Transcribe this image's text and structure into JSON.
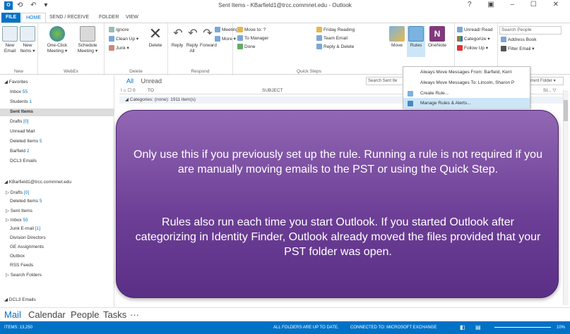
{
  "window": {
    "title": "Sent Items - KBarfield1@trcc.commnet.edu - Outlook",
    "quick_access": "⟲ ↶ ▾",
    "controls": "? ▣ – ☐ ✕"
  },
  "tabs": [
    "FILE",
    "HOME",
    "SEND / RECEIVE",
    "FOLDER",
    "VIEW"
  ],
  "ribbon": {
    "new_group": {
      "label": "New",
      "new_email": "New Email",
      "new_items": "New Items ▾"
    },
    "webex_group": {
      "label": "WebEx",
      "one_click": "One-Click Meeting ▾",
      "schedule": "Schedule Meeting ▾"
    },
    "delete_group": {
      "label": "Delete",
      "ignore": "Ignore",
      "clean_up": "Clean Up ▾",
      "junk": "Junk ▾",
      "delete": "Delete"
    },
    "respond_group": {
      "label": "Respond",
      "reply": "Reply",
      "reply_all": "Reply All",
      "forward": "Forward",
      "meeting": "Meeting",
      "more": "More ▾"
    },
    "quick_steps": {
      "label": "Quick Steps",
      "items": [
        "Move to: ?",
        "To Manager",
        "Done",
        "Friday Reading",
        "Team Email",
        "Reply & Delete"
      ]
    },
    "move_group": {
      "move": "Move",
      "rules": "Rules",
      "onenote": "OneNote"
    },
    "tags_group": {
      "unread_read": "Unread/ Read",
      "categorize": "Categorize ▾",
      "follow_up": "Follow Up ▾"
    },
    "find_group": {
      "search_people": "Search People",
      "address_book": "Address Book",
      "filter_email": "Filter Email ▾"
    }
  },
  "sidebar": {
    "favorites_head": "◢ Favorites",
    "favorites": [
      {
        "label": "Inbox",
        "count": "55"
      },
      {
        "label": "Students",
        "count": "1"
      },
      {
        "label": "Sent Items",
        "count": ""
      },
      {
        "label": "Drafts",
        "count": "[0]"
      },
      {
        "label": "Unread Mail",
        "count": ""
      },
      {
        "label": "Deleted Items",
        "count": "5"
      },
      {
        "label": "Barfield",
        "count": "2"
      },
      {
        "label": "DCL3 Emails",
        "count": ""
      }
    ],
    "account_head": "◢ KBarfield1@trcc.commnet.edu",
    "account": [
      {
        "label": "▷ Drafts",
        "count": "[0]"
      },
      {
        "label": "Deleted Items",
        "count": "5"
      },
      {
        "label": "▷ Sent Items",
        "count": ""
      },
      {
        "label": "▷ Inbox",
        "count": "55"
      },
      {
        "label": "Junk E-mail",
        "count": "[1]"
      },
      {
        "label": "Division Directors",
        "count": ""
      },
      {
        "label": "GE Assignments",
        "count": ""
      },
      {
        "label": "Outbox",
        "count": ""
      },
      {
        "label": "RSS Feeds",
        "count": ""
      },
      {
        "label": "▷ Search Folders",
        "count": ""
      }
    ],
    "dcl3_head": "◢ DCL3 Emails"
  },
  "list": {
    "filter_all": "All",
    "filter_unread": "Unread",
    "search_placeholder": "Search Sent Ite",
    "search_scope": "rrent Folder ▾",
    "col_icons": "! ⌂ ☐ 0",
    "col_to": "TO",
    "col_subject": "SUBJECT",
    "col_size": "SI... ▽",
    "category_group": "◢ Categories: (none): 1911 item(s)"
  },
  "rules_menu": {
    "items": [
      "Always Move Messages From: Barfield, Kerri",
      "Always Move Messages To: Lincoln, Sharon P",
      "Create Rule...",
      "Manage Rules & Alerts..."
    ]
  },
  "overlay": {
    "p1": "Only use this if you previously set up the rule. Running a rule is not required if you are manually moving emails to the PST or using the Quick Step.",
    "p2": "Rules also run each time you start Outlook. If you started Outlook after categorizing in Identity Finder, Outlook already moved the files provided that your PST folder was open."
  },
  "nav": [
    "Mail",
    "Calendar",
    "People",
    "Tasks",
    "···"
  ],
  "status": {
    "items": "ITEMS: 13,250",
    "folders": "ALL FOLDERS ARE UP TO DATE.",
    "connected": "CONNECTED TO: MICROSOFT EXCHANGE",
    "zoom": "10%"
  },
  "colors": {
    "accent": "#0072c6",
    "overlay": "#6d3f97"
  }
}
